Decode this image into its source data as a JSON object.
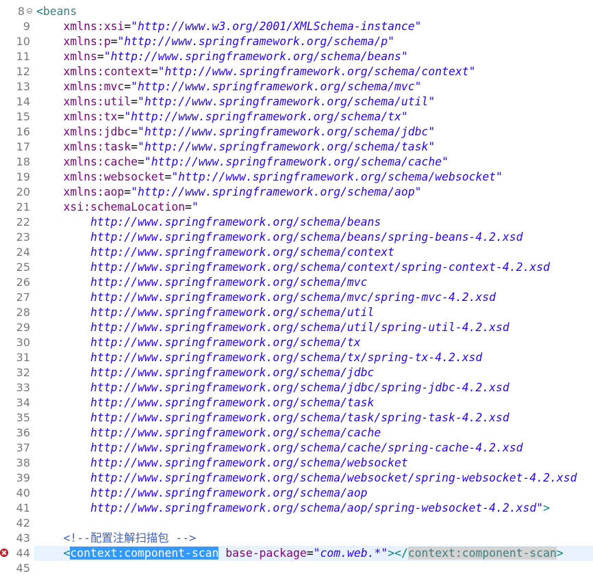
{
  "editor": {
    "first_line_number": 8,
    "error_line": 44,
    "current_line": 44,
    "error_icon": "error-icon",
    "fold_icon": "fold-collapse-icon",
    "lines": [
      {
        "n": "8",
        "tokens": [
          {
            "t": "<",
            "c": "bracket"
          },
          {
            "t": "beans",
            "c": "tag"
          }
        ],
        "fold": true
      },
      {
        "n": "9",
        "tokens": [
          {
            "t": "    ",
            "c": "plain"
          },
          {
            "t": "xmlns:xsi",
            "c": "attr"
          },
          {
            "t": "=",
            "c": "eq"
          },
          {
            "t": "\"http://www.w3.org/2001/XMLSchema-instance\"",
            "c": "value"
          }
        ]
      },
      {
        "n": "10",
        "tokens": [
          {
            "t": "    ",
            "c": "plain"
          },
          {
            "t": "xmlns:p",
            "c": "attr"
          },
          {
            "t": "=",
            "c": "eq"
          },
          {
            "t": "\"http://www.springframework.org/schema/p\"",
            "c": "value"
          }
        ]
      },
      {
        "n": "11",
        "tokens": [
          {
            "t": "    ",
            "c": "plain"
          },
          {
            "t": "xmlns",
            "c": "attr"
          },
          {
            "t": "=",
            "c": "eq"
          },
          {
            "t": "\"http://www.springframework.org/schema/beans\"",
            "c": "value"
          }
        ]
      },
      {
        "n": "12",
        "tokens": [
          {
            "t": "    ",
            "c": "plain"
          },
          {
            "t": "xmlns:context",
            "c": "attr"
          },
          {
            "t": "=",
            "c": "eq"
          },
          {
            "t": "\"http://www.springframework.org/schema/context\"",
            "c": "value"
          }
        ]
      },
      {
        "n": "13",
        "tokens": [
          {
            "t": "    ",
            "c": "plain"
          },
          {
            "t": "xmlns:mvc",
            "c": "attr"
          },
          {
            "t": "=",
            "c": "eq"
          },
          {
            "t": "\"http://www.springframework.org/schema/mvc\"",
            "c": "value"
          }
        ]
      },
      {
        "n": "14",
        "tokens": [
          {
            "t": "    ",
            "c": "plain"
          },
          {
            "t": "xmlns:util",
            "c": "attr"
          },
          {
            "t": "=",
            "c": "eq"
          },
          {
            "t": "\"http://www.springframework.org/schema/util\"",
            "c": "value"
          }
        ]
      },
      {
        "n": "15",
        "tokens": [
          {
            "t": "    ",
            "c": "plain"
          },
          {
            "t": "xmlns:tx",
            "c": "attr"
          },
          {
            "t": "=",
            "c": "eq"
          },
          {
            "t": "\"http://www.springframework.org/schema/tx\"",
            "c": "value"
          }
        ]
      },
      {
        "n": "16",
        "tokens": [
          {
            "t": "    ",
            "c": "plain"
          },
          {
            "t": "xmlns:jdbc",
            "c": "attr"
          },
          {
            "t": "=",
            "c": "eq"
          },
          {
            "t": "\"http://www.springframework.org/schema/jdbc\"",
            "c": "value"
          }
        ]
      },
      {
        "n": "17",
        "tokens": [
          {
            "t": "    ",
            "c": "plain"
          },
          {
            "t": "xmlns:task",
            "c": "attr"
          },
          {
            "t": "=",
            "c": "eq"
          },
          {
            "t": "\"http://www.springframework.org/schema/task\"",
            "c": "value"
          }
        ]
      },
      {
        "n": "18",
        "tokens": [
          {
            "t": "    ",
            "c": "plain"
          },
          {
            "t": "xmlns:cache",
            "c": "attr"
          },
          {
            "t": "=",
            "c": "eq"
          },
          {
            "t": "\"http://www.springframework.org/schema/cache\"",
            "c": "value"
          }
        ]
      },
      {
        "n": "19",
        "tokens": [
          {
            "t": "    ",
            "c": "plain"
          },
          {
            "t": "xmlns:websocket",
            "c": "attr"
          },
          {
            "t": "=",
            "c": "eq"
          },
          {
            "t": "\"http://www.springframework.org/schema/websocket\"",
            "c": "value"
          }
        ]
      },
      {
        "n": "20",
        "tokens": [
          {
            "t": "    ",
            "c": "plain"
          },
          {
            "t": "xmlns:aop",
            "c": "attr"
          },
          {
            "t": "=",
            "c": "eq"
          },
          {
            "t": "\"http://www.springframework.org/schema/aop\"",
            "c": "value"
          }
        ]
      },
      {
        "n": "21",
        "tokens": [
          {
            "t": "    ",
            "c": "plain"
          },
          {
            "t": "xsi:schemaLocation",
            "c": "attr"
          },
          {
            "t": "=",
            "c": "eq"
          },
          {
            "t": "\"",
            "c": "value"
          }
        ]
      },
      {
        "n": "22",
        "tokens": [
          {
            "t": "        ",
            "c": "plain"
          },
          {
            "t": "http://www.springframework.org/schema/beans",
            "c": "value"
          }
        ]
      },
      {
        "n": "23",
        "tokens": [
          {
            "t": "        ",
            "c": "plain"
          },
          {
            "t": "http://www.springframework.org/schema/beans/spring-beans-4.2.xsd",
            "c": "value"
          }
        ]
      },
      {
        "n": "24",
        "tokens": [
          {
            "t": "        ",
            "c": "plain"
          },
          {
            "t": "http://www.springframework.org/schema/context",
            "c": "value"
          }
        ]
      },
      {
        "n": "25",
        "tokens": [
          {
            "t": "        ",
            "c": "plain"
          },
          {
            "t": "http://www.springframework.org/schema/context/spring-context-4.2.xsd",
            "c": "value"
          }
        ]
      },
      {
        "n": "26",
        "tokens": [
          {
            "t": "        ",
            "c": "plain"
          },
          {
            "t": "http://www.springframework.org/schema/mvc",
            "c": "value"
          }
        ]
      },
      {
        "n": "27",
        "tokens": [
          {
            "t": "        ",
            "c": "plain"
          },
          {
            "t": "http://www.springframework.org/schema/mvc/spring-mvc-4.2.xsd",
            "c": "value"
          }
        ]
      },
      {
        "n": "28",
        "tokens": [
          {
            "t": "        ",
            "c": "plain"
          },
          {
            "t": "http://www.springframework.org/schema/util",
            "c": "value"
          }
        ]
      },
      {
        "n": "29",
        "tokens": [
          {
            "t": "        ",
            "c": "plain"
          },
          {
            "t": "http://www.springframework.org/schema/util/spring-util-4.2.xsd",
            "c": "value"
          }
        ]
      },
      {
        "n": "30",
        "tokens": [
          {
            "t": "        ",
            "c": "plain"
          },
          {
            "t": "http://www.springframework.org/schema/tx",
            "c": "value"
          }
        ]
      },
      {
        "n": "31",
        "tokens": [
          {
            "t": "        ",
            "c": "plain"
          },
          {
            "t": "http://www.springframework.org/schema/tx/spring-tx-4.2.xsd",
            "c": "value"
          }
        ]
      },
      {
        "n": "32",
        "tokens": [
          {
            "t": "        ",
            "c": "plain"
          },
          {
            "t": "http://www.springframework.org/schema/jdbc",
            "c": "value"
          }
        ]
      },
      {
        "n": "33",
        "tokens": [
          {
            "t": "        ",
            "c": "plain"
          },
          {
            "t": "http://www.springframework.org/schema/jdbc/spring-jdbc-4.2.xsd",
            "c": "value"
          }
        ]
      },
      {
        "n": "34",
        "tokens": [
          {
            "t": "        ",
            "c": "plain"
          },
          {
            "t": "http://www.springframework.org/schema/task",
            "c": "value"
          }
        ]
      },
      {
        "n": "35",
        "tokens": [
          {
            "t": "        ",
            "c": "plain"
          },
          {
            "t": "http://www.springframework.org/schema/task/spring-task-4.2.xsd",
            "c": "value"
          }
        ]
      },
      {
        "n": "36",
        "tokens": [
          {
            "t": "        ",
            "c": "plain"
          },
          {
            "t": "http://www.springframework.org/schema/cache",
            "c": "value"
          }
        ]
      },
      {
        "n": "37",
        "tokens": [
          {
            "t": "        ",
            "c": "plain"
          },
          {
            "t": "http://www.springframework.org/schema/cache/spring-cache-4.2.xsd",
            "c": "value"
          }
        ]
      },
      {
        "n": "38",
        "tokens": [
          {
            "t": "        ",
            "c": "plain"
          },
          {
            "t": "http://www.springframework.org/schema/websocket",
            "c": "value"
          }
        ]
      },
      {
        "n": "39",
        "tokens": [
          {
            "t": "        ",
            "c": "plain"
          },
          {
            "t": "http://www.springframework.org/schema/websocket/spring-websocket-4.2.xsd",
            "c": "value"
          }
        ]
      },
      {
        "n": "40",
        "tokens": [
          {
            "t": "        ",
            "c": "plain"
          },
          {
            "t": "http://www.springframework.org/schema/aop",
            "c": "value"
          }
        ]
      },
      {
        "n": "41",
        "tokens": [
          {
            "t": "        ",
            "c": "plain"
          },
          {
            "t": "http://www.springframework.org/schema/aop/spring-websocket-4.2.xsd\"",
            "c": "value"
          },
          {
            "t": ">",
            "c": "bracket"
          }
        ]
      },
      {
        "n": "42",
        "tokens": []
      },
      {
        "n": "43",
        "tokens": [
          {
            "t": "    ",
            "c": "plain"
          },
          {
            "t": "<!--配置注解扫描包 -->",
            "c": "comment"
          }
        ]
      },
      {
        "n": "44",
        "tokens": [
          {
            "t": "    ",
            "c": "plain"
          },
          {
            "t": "<",
            "c": "bracket"
          },
          {
            "t": "context:component-scan",
            "c": "selected"
          },
          {
            "t": " ",
            "c": "plain"
          },
          {
            "t": "base-package",
            "c": "attr"
          },
          {
            "t": "=",
            "c": "eq"
          },
          {
            "t": "\"com.web.*\"",
            "c": "value"
          },
          {
            "t": "></",
            "c": "bracket"
          },
          {
            "t": "context:component-scan",
            "c": "matched"
          },
          {
            "t": ">",
            "c": "bracket"
          }
        ],
        "error": true
      },
      {
        "n": "45",
        "tokens": []
      }
    ]
  }
}
